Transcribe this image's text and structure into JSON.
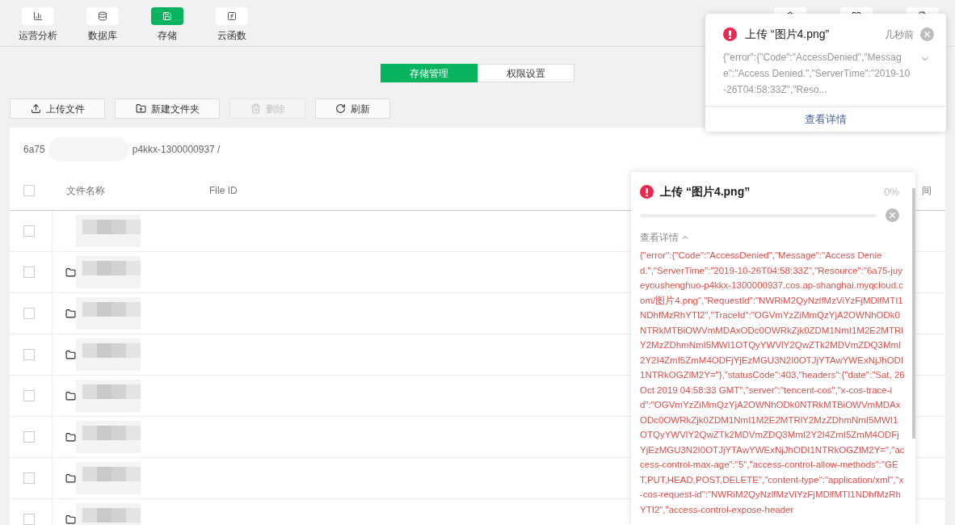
{
  "nav": [
    {
      "label": "运营分析",
      "selected": false
    },
    {
      "label": "数据库",
      "selected": false
    },
    {
      "label": "存储",
      "selected": true
    },
    {
      "label": "云函数",
      "selected": false
    }
  ],
  "tabs": [
    {
      "label": "存储管理",
      "selected": true
    },
    {
      "label": "权限设置",
      "selected": false
    }
  ],
  "toolbar": [
    {
      "label": "上传文件",
      "disabled": false
    },
    {
      "label": "新建文件夹",
      "disabled": false
    },
    {
      "label": "删除",
      "disabled": true
    },
    {
      "label": "刷新",
      "disabled": false
    }
  ],
  "breadcrumb": [
    "6a75",
    "p4kkx-1300000937 /"
  ],
  "table": {
    "select_all": {
      "checked": false
    },
    "columns": [
      "文件名称",
      "File ID",
      "间"
    ],
    "rows": [
      {
        "checked": false,
        "kind": "hidden"
      },
      {
        "checked": false,
        "kind": "folder"
      },
      {
        "checked": false,
        "kind": "folder"
      },
      {
        "checked": false,
        "kind": "folder"
      },
      {
        "checked": false,
        "kind": "folder"
      },
      {
        "checked": false,
        "kind": "folder"
      },
      {
        "checked": false,
        "kind": "folder"
      },
      {
        "checked": false,
        "kind": "folder"
      }
    ]
  },
  "toast": {
    "title": "上传 “图片4.png”",
    "time": "几秒前",
    "message": "{\"error\":{\"Code\":\"AccessDenied\",\"Message\":\"Access Denied.\",\"ServerTime\":\"2019-10-26T04:58:33Z\",\"Reso...",
    "link": "查看详情"
  },
  "upload_panel": {
    "title": "上传 “图片4.png”",
    "percent": "0%",
    "level": 0,
    "details_toggle": "查看详情",
    "expanded": true,
    "details": "{\"error\":{\"Code\":\"AccessDenied\",\"Message\":\"Access Denied.\",\"ServerTime\":\"2019-10-26T04:58:33Z\",\"Resource\":\"6a75-juyeyoushenghuo-p4kkx-1300000937.cos.ap-shanghai.myqcloud.com/图片4.png\",\"RequestId\":\"NWRiM2QyNzlfMzViYzFjMDlfMTI1NDhfMzRhYTI2\",\"TraceId\":\"OGVmYzZiMmQzYjA2OWNhODk0NTRkMTBiOWVmMDAxODc0OWRkZjk0ZDM1NmI1M2E2MTRlY2MzZDhmNmI5MWI1OTQyYWVlY2QwZTk2MDVmZDQ3MmI2Y2I4ZmI5ZmM4ODFjYjEzMGU3N2I0OTJjYTAwYWExNjJhODI1NTRkOGZlM2Y=\"},\"statusCode\":403,\"headers\":{\"date\":\"Sat, 26 Oct 2019 04:58:33 GMT\",\"server\":\"tencent-cos\",\"x-cos-trace-id\":\"OGVmYzZiMmQzYjA2OWNhODk0NTRkMTBiOWVmMDAxODc0OWRkZjk0ZDM1NmI1M2E2MTRlY2MzZDhmNmI5MWI1OTQyYWVlY2QwZTk2MDVmZDQ3MmI2Y2I4ZmI5ZmM4ODFjYjEzMGU3N2I0OTJjYTAwYWExNjJhODI1NTRkOGZlM2Y=\",\"access-control-max-age\":\"5\",\"access-control-allow-methods\":\"GET,PUT,HEAD,POST,DELETE\",\"content-type\":\"application/xml\",\"x-cos-request-id\":\"NWRiM2QyNzlfMzViYzFjMDlfMTI1NDhfMzRhYTI2\",\"access-control-expose-header"
  }
}
